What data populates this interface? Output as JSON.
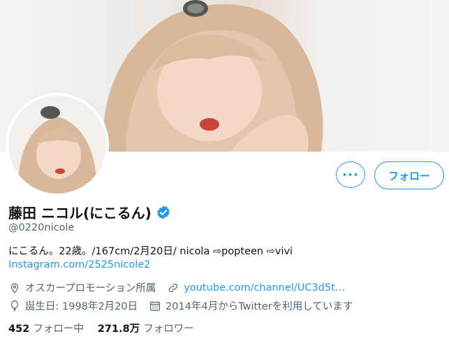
{
  "profile": {
    "name": "藤田 ニコル(にこるん)",
    "handle": "@0220nicole",
    "bio": "にこるん。22歳。/167cm/2月20日/ nicola ⇨popteen ⇨vivi",
    "bio_link": "Instagram.com/2525nicole2",
    "location": "オスカープロモーション所属",
    "website": "youtube.com/channel/UC3d5t…",
    "birthday": "誕生日: 1998年2月20日",
    "joined": "2014年4月からTwitterを利用しています",
    "following_count": "452",
    "following_label": "フォロー中",
    "followers_count": "271.8万",
    "followers_label": "フォロワー"
  },
  "actions": {
    "more_label": "•••",
    "follow_label": "フォロー"
  },
  "colors": {
    "accent": "#1d9bf0",
    "secondary_text": "#536471"
  },
  "icons": {
    "verified": "verified-badge-icon",
    "location": "location-pin-icon",
    "link": "link-icon",
    "birthday": "balloon-icon",
    "calendar": "calendar-icon"
  }
}
